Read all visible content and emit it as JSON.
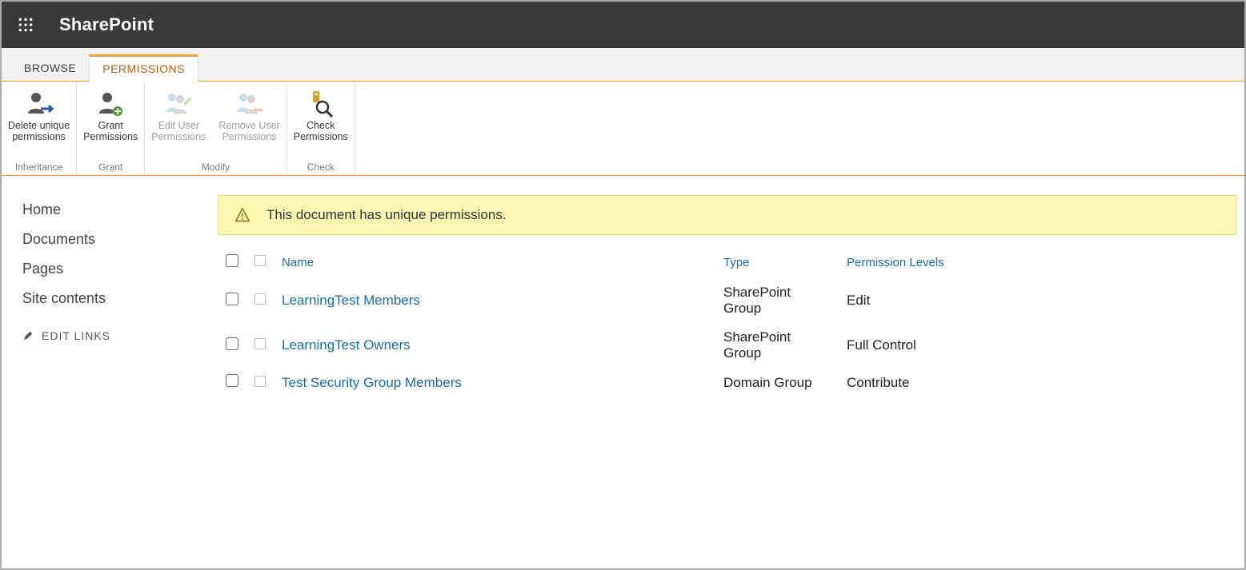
{
  "brand": "SharePoint",
  "tabs": {
    "browse": "BROWSE",
    "permissions": "PERMISSIONS"
  },
  "ribbon": {
    "inheritance": {
      "title": "Inheritance",
      "delete_unique": "Delete unique\npermissions"
    },
    "grant": {
      "title": "Grant",
      "grant_perm": "Grant\nPermissions"
    },
    "modify": {
      "title": "Modify",
      "edit_user": "Edit User\nPermissions",
      "remove_user": "Remove User\nPermissions"
    },
    "check": {
      "title": "Check",
      "check_perm": "Check\nPermissions"
    }
  },
  "leftnav": {
    "home": "Home",
    "documents": "Documents",
    "pages": "Pages",
    "site_contents": "Site contents",
    "edit_links": "EDIT LINKS"
  },
  "notice": "This document has unique permissions.",
  "table": {
    "headers": {
      "name": "Name",
      "type": "Type",
      "level": "Permission Levels"
    },
    "rows": [
      {
        "name": "LearningTest Members",
        "type": "SharePoint Group",
        "level": "Edit"
      },
      {
        "name": "LearningTest Owners",
        "type": "SharePoint Group",
        "level": "Full Control"
      },
      {
        "name": "Test Security Group Members",
        "type": "Domain Group",
        "level": "Contribute"
      }
    ]
  }
}
